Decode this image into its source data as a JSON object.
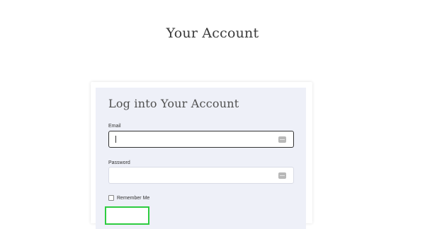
{
  "page": {
    "title": "Your Account"
  },
  "login_form": {
    "heading": "Log into Your Account",
    "email": {
      "label": "Email",
      "value": "",
      "placeholder": "",
      "focused": true
    },
    "password": {
      "label": "Password",
      "value": "",
      "placeholder": ""
    },
    "remember_me": {
      "label": "Remember Me",
      "checked": false
    },
    "submit": {
      "label": ""
    }
  },
  "colors": {
    "card_background": "#eef0f8",
    "focus_outline": "#2ecc40",
    "heading_text": "#505050"
  },
  "icons": {
    "input_suffix": "password-manager-key-icon"
  }
}
